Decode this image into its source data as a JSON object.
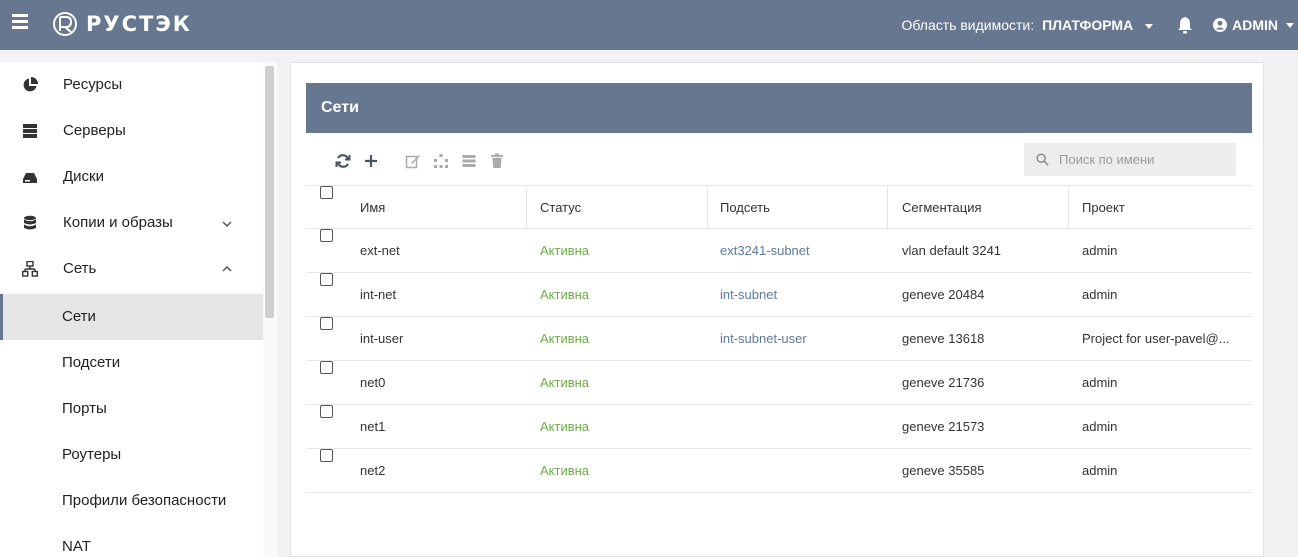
{
  "app": {
    "brand": "РУСТЭК",
    "scope_label": "Область видимости:",
    "scope_value": "ПЛАТФОРМА",
    "user_name": "ADMIN",
    "accent_color": "#66778f",
    "active_color": "#6dab48",
    "link_color": "#5d7a98"
  },
  "sidebar": {
    "items": [
      {
        "label": "Ресурсы",
        "icon": "pie-chart-icon"
      },
      {
        "label": "Серверы",
        "icon": "server-icon"
      },
      {
        "label": "Диски",
        "icon": "disk-icon"
      },
      {
        "label": "Копии и образы",
        "icon": "database-icon",
        "expanded": false
      },
      {
        "label": "Сеть",
        "icon": "network-icon",
        "expanded": true
      }
    ],
    "subitems": [
      {
        "label": "Сети",
        "active": true
      },
      {
        "label": "Подсети"
      },
      {
        "label": "Порты"
      },
      {
        "label": "Роутеры"
      },
      {
        "label": "Профили безопасности"
      },
      {
        "label": "NAT"
      }
    ]
  },
  "panel": {
    "title": "Сети",
    "search_placeholder": "Поиск по имени",
    "toolbar": [
      "refresh-icon",
      "add-icon",
      "edit-icon",
      "topology-icon",
      "list-icon",
      "delete-icon"
    ]
  },
  "table": {
    "columns": [
      "Имя",
      "Статус",
      "Подсеть",
      "Сегментация",
      "Проект"
    ],
    "rows": [
      {
        "name": "ext-net",
        "status": "Активна",
        "subnet": "ext3241-subnet",
        "segmentation": "vlan default 3241",
        "project": "admin"
      },
      {
        "name": "int-net",
        "status": "Активна",
        "subnet": "int-subnet",
        "segmentation": "geneve 20484",
        "project": "admin"
      },
      {
        "name": "int-user",
        "status": "Активна",
        "subnet": "int-subnet-user",
        "segmentation": "geneve 13618",
        "project": "Project for user-pavel@..."
      },
      {
        "name": "net0",
        "status": "Активна",
        "subnet": "",
        "segmentation": "geneve 21736",
        "project": "admin"
      },
      {
        "name": "net1",
        "status": "Активна",
        "subnet": "",
        "segmentation": "geneve 21573",
        "project": "admin"
      },
      {
        "name": "net2",
        "status": "Активна",
        "subnet": "",
        "segmentation": "geneve 35585",
        "project": "admin"
      }
    ]
  }
}
